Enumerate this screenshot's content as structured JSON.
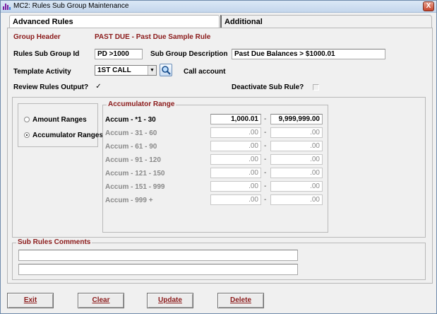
{
  "window": {
    "title": "MC2: Rules Sub Group Maintenance",
    "close_glyph": "X"
  },
  "tabs": {
    "active": "Advanced Rules",
    "inactive": "Additional"
  },
  "header": {
    "group_header_label": "Group Header",
    "group_header_value": "PAST DUE - Past Due Sample Rule",
    "sub_group_id_label": "Rules Sub Group Id",
    "sub_group_id_value": "PD >1000",
    "sub_group_desc_label": "Sub Group Description",
    "sub_group_desc_value": "Past Due Balances > $1000.01",
    "template_activity_label": "Template Activity",
    "template_activity_value": "1ST CALL",
    "template_activity_desc": "Call account",
    "review_output_label": "Review Rules Output?",
    "review_output_checked": true,
    "review_output_glyph": "✓",
    "deactivate_label": "Deactivate Sub Rule?",
    "deactivate_checked": false
  },
  "range_type": {
    "amount_label": "Amount Ranges",
    "accumulator_label": "Accumulator Ranges",
    "selected": "accumulator"
  },
  "accumulator": {
    "title": "Accumulator Range",
    "dash": "-",
    "rows": [
      {
        "label": "Accum - *1 - 30",
        "from": "1,000.01",
        "to": "9,999,999.00",
        "enabled": true
      },
      {
        "label": "Accum - 31 - 60",
        "from": ".00",
        "to": ".00",
        "enabled": false
      },
      {
        "label": "Accum - 61 - 90",
        "from": ".00",
        "to": ".00",
        "enabled": false
      },
      {
        "label": "Accum - 91 - 120",
        "from": ".00",
        "to": ".00",
        "enabled": false
      },
      {
        "label": "Accum - 121 - 150",
        "from": ".00",
        "to": ".00",
        "enabled": false
      },
      {
        "label": "Accum - 151 - 999",
        "from": ".00",
        "to": ".00",
        "enabled": false
      },
      {
        "label": "Accum - 999 +",
        "from": ".00",
        "to": ".00",
        "enabled": false
      }
    ]
  },
  "comments": {
    "title": "Sub Rules Comments",
    "line1": "",
    "line2": ""
  },
  "buttons": {
    "exit": "Exit",
    "clear": "Clear",
    "update": "Update",
    "delete": "Delete"
  },
  "colors": {
    "accent": "#8b1a1a",
    "disabled_text": "#8a8a8a"
  },
  "icons": {
    "app": "chart-bars-icon",
    "lookup": "magnifier-icon",
    "dropdown": "chevron-down-icon",
    "close": "close-icon"
  }
}
